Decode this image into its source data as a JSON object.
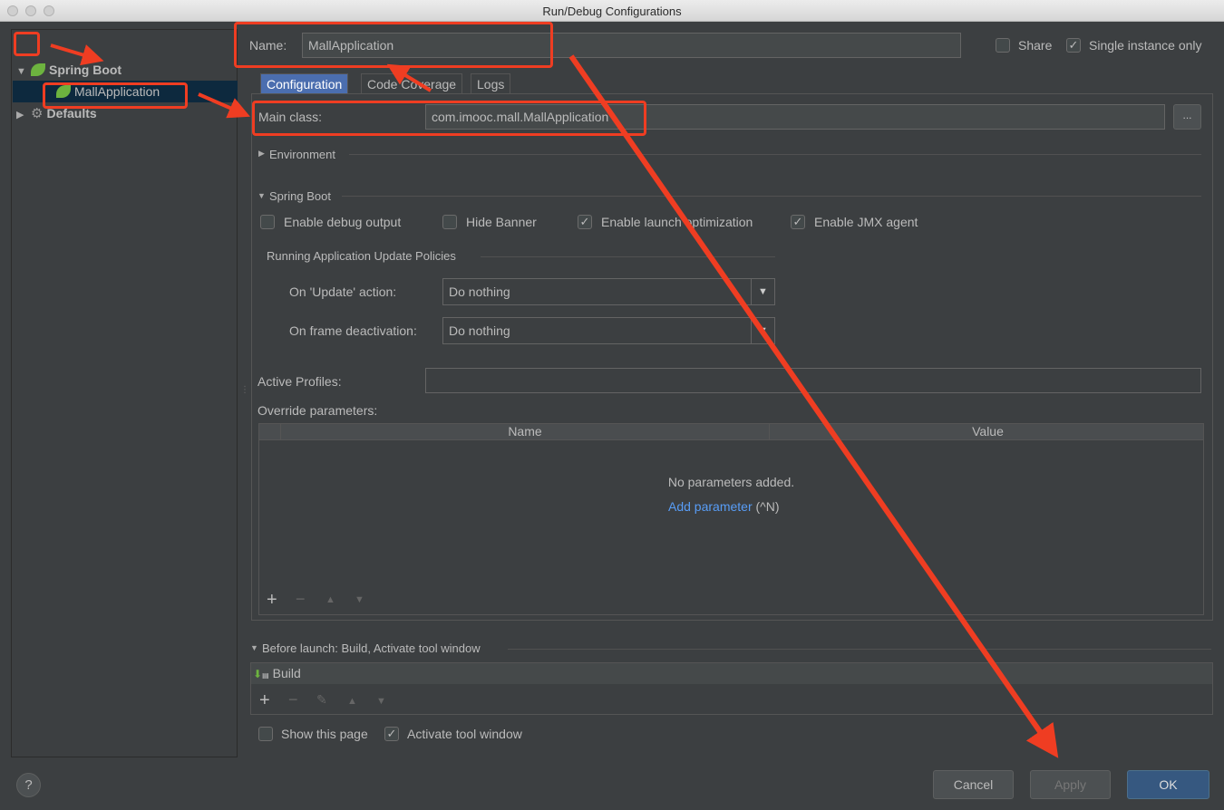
{
  "window": {
    "title": "Run/Debug Configurations"
  },
  "tree": {
    "group_label": "Spring Boot",
    "item_label": "MallApplication",
    "defaults_label": "Defaults"
  },
  "header": {
    "name_label": "Name:",
    "name_value": "MallApplication",
    "share_label": "Share",
    "single_instance_label": "Single instance only"
  },
  "tabs": [
    {
      "label": "Configuration"
    },
    {
      "label": "Code Coverage"
    },
    {
      "label": "Logs"
    }
  ],
  "main_class": {
    "label": "Main class:",
    "value": "com.imooc.mall.MallApplication",
    "browse": "..."
  },
  "environment_label": "Environment",
  "spring_boot": {
    "label": "Spring Boot",
    "enable_debug": "Enable debug output",
    "hide_banner": "Hide Banner",
    "launch_opt": "Enable launch optimization",
    "jmx": "Enable JMX agent",
    "policies_label": "Running Application Update Policies",
    "update_label": "On 'Update' action:",
    "update_value": "Do nothing",
    "frame_label": "On frame deactivation:",
    "frame_value": "Do nothing"
  },
  "active_profiles_label": "Active Profiles:",
  "override": {
    "label": "Override parameters:",
    "col_name": "Name",
    "col_value": "Value",
    "empty_text": "No parameters added.",
    "add_link": "Add parameter",
    "add_shortcut": " (^N)"
  },
  "before_launch": {
    "label": "Before launch: Build, Activate tool window",
    "item": "Build"
  },
  "footer": {
    "show_page": "Show this page",
    "activate_window": "Activate tool window",
    "cancel": "Cancel",
    "apply": "Apply",
    "ok": "OK",
    "help": "?"
  },
  "colors": {
    "accent": "#4b6eaf",
    "annotation": "#ef3d22",
    "link": "#589df6"
  }
}
